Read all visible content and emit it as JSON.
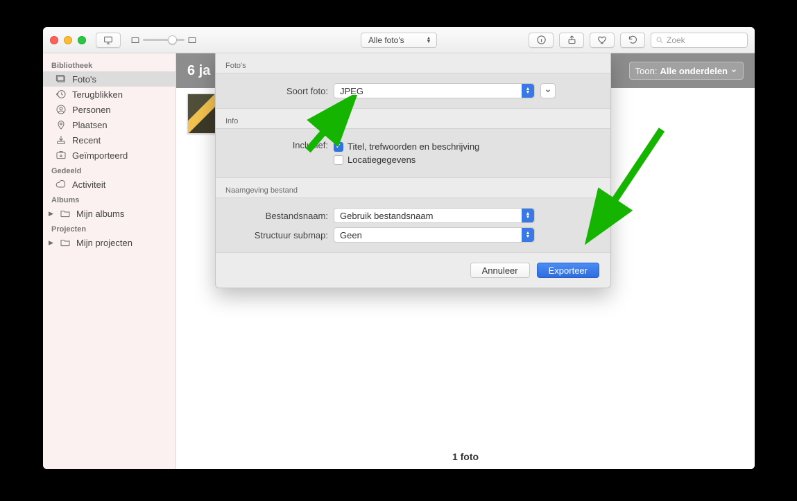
{
  "toolbar": {
    "view_selector": "Alle foto's",
    "search_placeholder": "Zoek"
  },
  "sidebar": {
    "sections": {
      "library": "Bibliotheek",
      "shared": "Gedeeld",
      "albums": "Albums",
      "projects": "Projecten"
    },
    "items": {
      "photos": "Foto's",
      "memories": "Terugblikken",
      "people": "Personen",
      "places": "Plaatsen",
      "recent": "Recent",
      "imported": "Geïmporteerd",
      "activity": "Activiteit",
      "my_albums": "Mijn albums",
      "my_projects": "Mijn projecten"
    }
  },
  "header": {
    "title_fragment": "6 ja",
    "show_label": "Toon:",
    "show_value": "Alle onderdelen"
  },
  "footer": {
    "count": "1 foto"
  },
  "sheet": {
    "sections": {
      "photos": "Foto's",
      "info": "Info",
      "naming": "Naamgeving bestand"
    },
    "labels": {
      "kind": "Soort foto:",
      "including": "Inclusief:",
      "filename": "Bestandsnaam:",
      "subfolder": "Structuur submap:"
    },
    "values": {
      "kind": "JPEG",
      "include_title": "Titel, trefwoorden en beschrijving",
      "include_location": "Locatiegegevens",
      "filename": "Gebruik bestandsnaam",
      "subfolder": "Geen"
    },
    "buttons": {
      "cancel": "Annuleer",
      "export": "Exporteer"
    }
  }
}
